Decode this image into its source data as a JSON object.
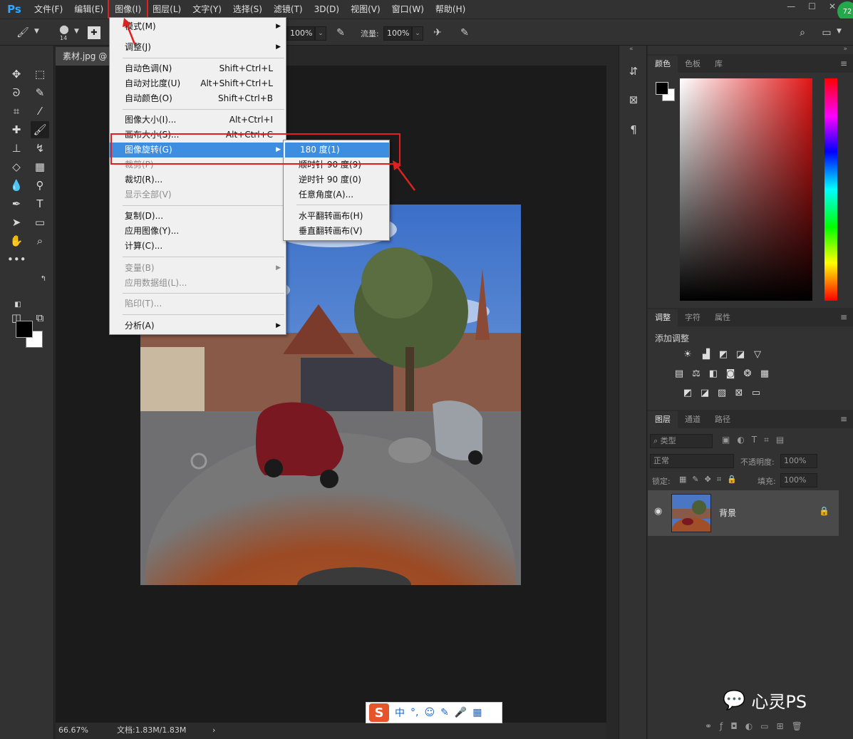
{
  "menubar": {
    "logo": "Ps",
    "items": [
      "文件(F)",
      "编辑(E)",
      "图像(I)",
      "图层(L)",
      "文字(Y)",
      "选择(S)",
      "滤镜(T)",
      "3D(D)",
      "视图(V)",
      "窗口(W)",
      "帮助(H)"
    ],
    "active_item": "图像(I)",
    "badge": "72"
  },
  "options": {
    "brush_size": "14",
    "opacity_value": "100%",
    "flow_label": "流量:",
    "flow_value": "100%"
  },
  "document": {
    "tab_title": "素材.jpg @",
    "zoom": "66.67%",
    "doc_info": "文档:1.83M/1.83M"
  },
  "image_menu": [
    {
      "label": "模式(M)",
      "submenu": true
    },
    {
      "label": "调整(J)",
      "submenu": true
    },
    {
      "label": "自动色调(N)",
      "shortcut": "Shift+Ctrl+L"
    },
    {
      "label": "自动对比度(U)",
      "shortcut": "Alt+Shift+Ctrl+L"
    },
    {
      "label": "自动颜色(O)",
      "shortcut": "Shift+Ctrl+B"
    },
    {
      "label": "图像大小(I)...",
      "shortcut": "Alt+Ctrl+I"
    },
    {
      "label": "画布大小(S)...",
      "shortcut": "Alt+Ctrl+C"
    },
    {
      "label": "图像旋转(G)",
      "submenu": true,
      "highlighted": true
    },
    {
      "label": "裁剪(P)",
      "disabled": true
    },
    {
      "label": "裁切(R)..."
    },
    {
      "label": "显示全部(V)",
      "disabled": true
    },
    {
      "label": "复制(D)..."
    },
    {
      "label": "应用图像(Y)..."
    },
    {
      "label": "计算(C)..."
    },
    {
      "label": "变量(B)",
      "disabled": true,
      "submenu": true
    },
    {
      "label": "应用数据组(L)...",
      "disabled": true
    },
    {
      "label": "陷印(T)...",
      "disabled": true
    },
    {
      "label": "分析(A)",
      "submenu": true
    }
  ],
  "rotate_submenu": [
    {
      "label": "180 度(1)",
      "highlighted": true
    },
    {
      "label": "顺时针 90 度(9)"
    },
    {
      "label": "逆时针 90 度(0)"
    },
    {
      "label": "任意角度(A)..."
    },
    {
      "label": "水平翻转画布(H)"
    },
    {
      "label": "垂直翻转画布(V)"
    }
  ],
  "color_panel": {
    "tabs": [
      "颜色",
      "色板",
      "库"
    ]
  },
  "adjust_panel": {
    "tabs": [
      "调整",
      "字符",
      "属性"
    ],
    "heading": "添加调整"
  },
  "layers_panel": {
    "tabs": [
      "图层",
      "通道",
      "路径"
    ],
    "filter_placeholder": "类型",
    "blend_mode": "正常",
    "opacity_label": "不透明度:",
    "opacity_value": "100%",
    "lock_label": "锁定:",
    "fill_label": "填充:",
    "fill_value": "100%",
    "layer_name": "背景"
  },
  "ime": {
    "logo": "S",
    "mode": "中"
  },
  "watermark": {
    "text": "心灵PS"
  },
  "colors": {
    "accent": "#31a8ff",
    "highlight": "#3d8ee0",
    "annotation_red": "#e02020"
  }
}
